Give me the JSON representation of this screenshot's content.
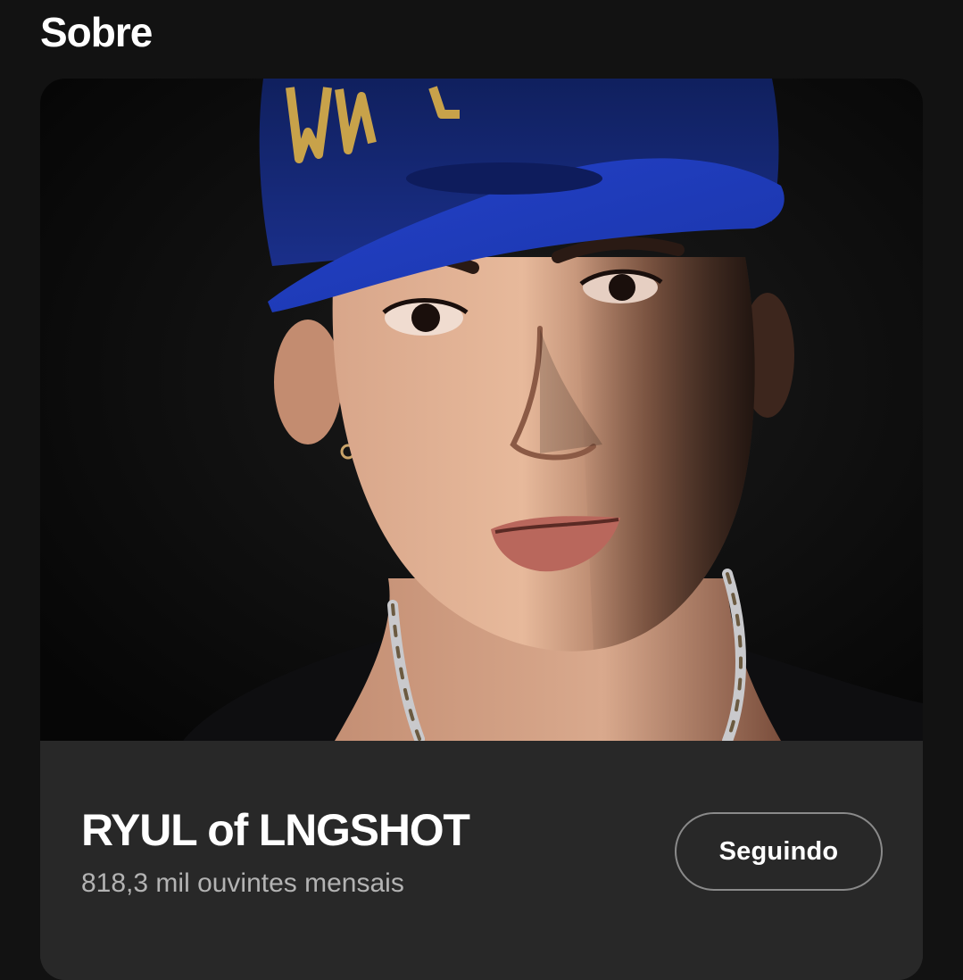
{
  "section": {
    "title": "Sobre"
  },
  "artist": {
    "name": "RYUL of LNGSHOT",
    "monthly_listeners": "818,3 mil ouvintes mensais",
    "follow_button_label": "Seguindo",
    "photo_description": "artist portrait"
  },
  "colors": {
    "background": "#121212",
    "card": "#282828",
    "text_primary": "#ffffff",
    "text_secondary": "#b3b3b3",
    "button_border": "#8a8a8a",
    "cap_blue": "#1f36b8"
  }
}
